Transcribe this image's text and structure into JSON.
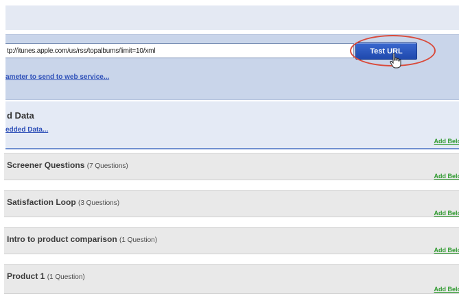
{
  "url_panel": {
    "url_value": "tp://itunes.apple.com/us/rss/topalbums/limit=10/xml",
    "test_button_label": "Test URL",
    "param_link": "ameter to send to web service..."
  },
  "embedded": {
    "title": "d Data",
    "link": "edded Data...",
    "add_below": "Add Below"
  },
  "sections": [
    {
      "title": "Screener Questions",
      "count": "(7 Questions)",
      "add_below": "Add Below"
    },
    {
      "title": "Satisfaction Loop",
      "count": "(3 Questions)",
      "add_below": "Add Below"
    },
    {
      "title": "Intro to product comparison",
      "count": "(1 Question)",
      "add_below": "Add Below"
    },
    {
      "title": "Product 1",
      "count": "(1 Question)",
      "add_below": "Add Below"
    }
  ],
  "colors": {
    "accent_button": "#2a56bd",
    "highlight_ring": "#d94a3a",
    "link_blue": "#2d4fb8",
    "link_green": "#2f9a2f"
  },
  "icons": {
    "cursor": "hand-pointer-icon"
  }
}
